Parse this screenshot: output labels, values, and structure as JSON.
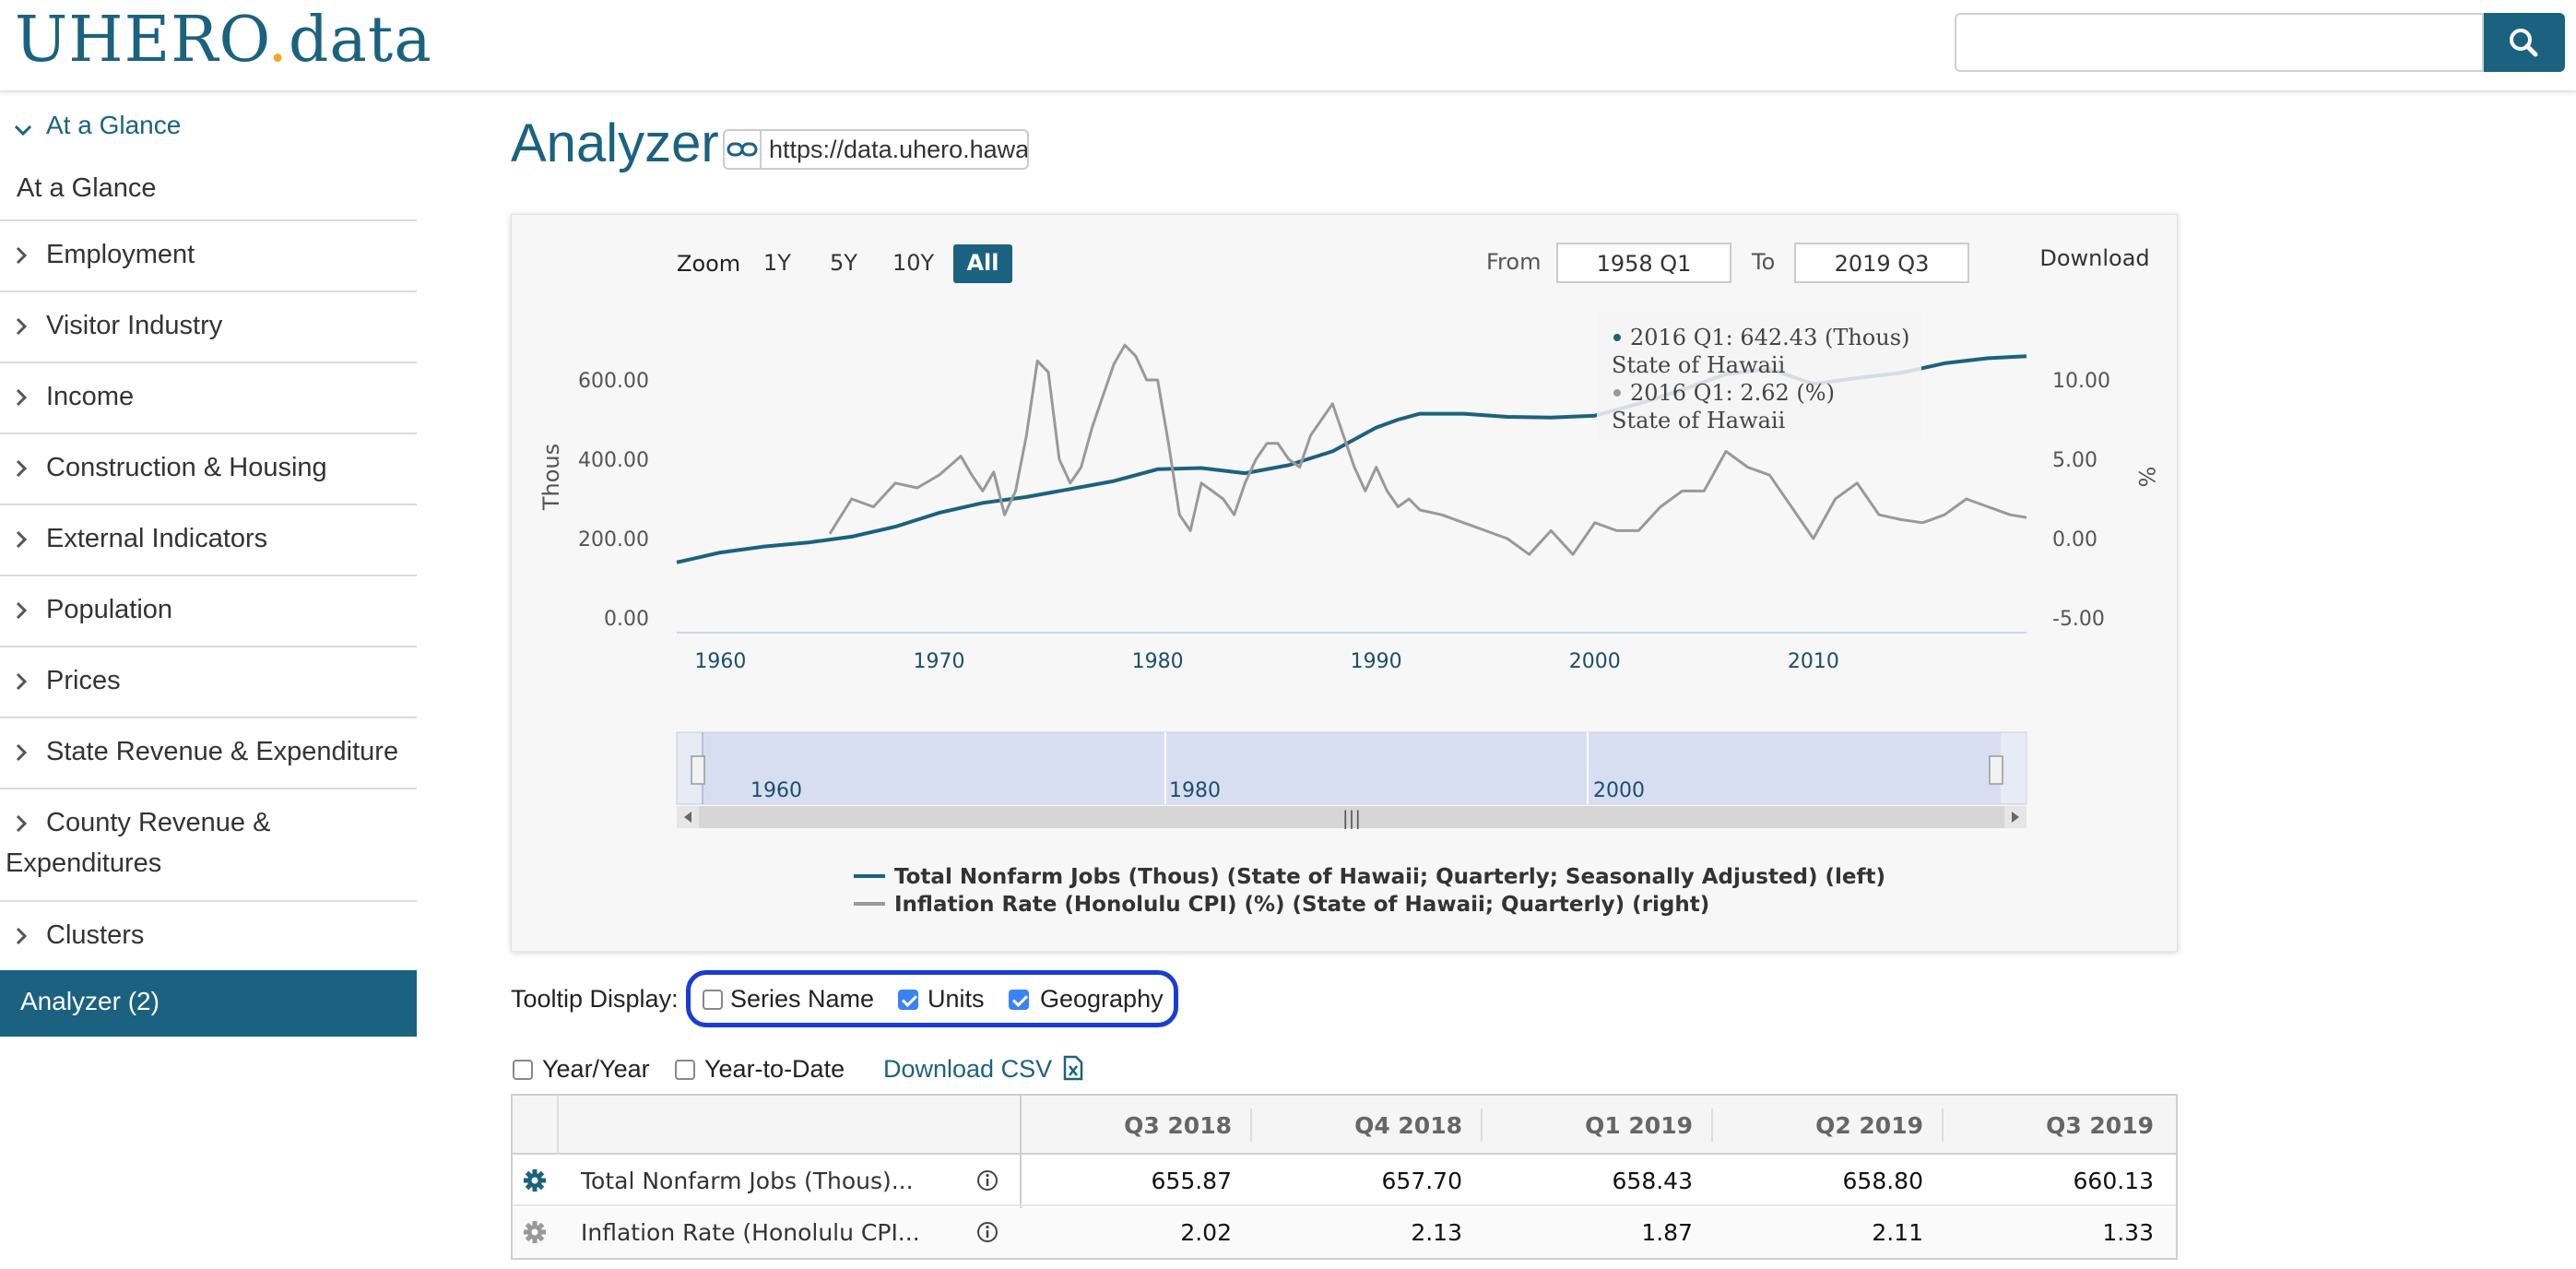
{
  "header": {
    "logo_text_a": "UHERO",
    "logo_text_b": ".",
    "logo_text_c": "data",
    "search_placeholder": ""
  },
  "sidebar": {
    "section_title": "At a Glance",
    "items": [
      {
        "label": "At a Glance",
        "chevron": false
      },
      {
        "label": "Employment",
        "chevron": true
      },
      {
        "label": "Visitor Industry",
        "chevron": true
      },
      {
        "label": "Income",
        "chevron": true
      },
      {
        "label": "Construction & Housing",
        "chevron": true
      },
      {
        "label": "External Indicators",
        "chevron": true
      },
      {
        "label": "Population",
        "chevron": true
      },
      {
        "label": "Prices",
        "chevron": true
      },
      {
        "label": "State Revenue & Expenditure",
        "chevron": true
      },
      {
        "label_line1": "County Revenue &",
        "label_line2": "Expenditures",
        "chevron": true
      },
      {
        "label": "Clusters",
        "chevron": true
      }
    ],
    "active_item": "Analyzer (2)"
  },
  "main": {
    "title": "Analyzer",
    "url_value": "https://data.uhero.hawaii.gov"
  },
  "chart_controls": {
    "zoom_label": "Zoom",
    "zoom_buttons": [
      "1Y",
      "5Y",
      "10Y",
      "All"
    ],
    "zoom_active": "All",
    "from_label": "From",
    "from_value": "1958 Q1",
    "to_label": "To",
    "to_value": "2019 Q3",
    "download_label": "Download"
  },
  "tooltip": {
    "line1": "2016 Q1: 642.43 (Thous)",
    "line2": "State of Hawaii",
    "line3": "2016 Q1: 2.62 (%)",
    "line4": "State of Hawaii"
  },
  "chart_data": {
    "type": "line",
    "x_range": [
      1958,
      2019.75
    ],
    "left_axis": {
      "label": "Thous",
      "ticks": [
        "0.00",
        "200.00",
        "400.00",
        "600.00"
      ],
      "range": [
        0,
        600
      ]
    },
    "right_axis": {
      "label": "%",
      "ticks": [
        "-5.00",
        "0.00",
        "5.00",
        "10.00"
      ],
      "range": [
        -5,
        10
      ]
    },
    "x_ticks": [
      "1960",
      "1970",
      "1980",
      "1990",
      "2000",
      "2010"
    ],
    "navigator_ticks": [
      "1960",
      "1980",
      "2000"
    ],
    "series": [
      {
        "name": "Total Nonfarm Jobs (Thous) (State of Hawaii; Quarterly; Seasonally Adjusted) (left)",
        "color": "#1b6280",
        "axis": "left",
        "x": [
          1958,
          1960,
          1962,
          1964,
          1966,
          1968,
          1970,
          1972,
          1974,
          1976,
          1978,
          1980,
          1982,
          1984,
          1986,
          1988,
          1990,
          1991,
          1992,
          1994,
          1996,
          1998,
          2000,
          2002,
          2004,
          2006,
          2008,
          2010,
          2012,
          2014,
          2016,
          2018,
          2019.75
        ],
        "y": [
          140,
          165,
          180,
          190,
          205,
          230,
          265,
          290,
          305,
          325,
          345,
          375,
          378,
          365,
          385,
          420,
          480,
          500,
          515,
          515,
          507,
          505,
          510,
          540,
          575,
          615,
          628,
          590,
          605,
          618,
          642,
          655,
          660
        ]
      },
      {
        "name": "Inflation Rate (Honolulu CPI) (%) (State of Hawaii; Quarterly) (right)",
        "color": "#999999",
        "axis": "right",
        "x": [
          1965,
          1966,
          1967,
          1968,
          1969,
          1970,
          1971,
          1971.5,
          1972,
          1972.5,
          1973,
          1973.5,
          1974,
          1974.5,
          1975,
          1975.5,
          1976,
          1976.5,
          1977,
          1977.5,
          1978,
          1978.5,
          1979,
          1979.5,
          1980,
          1980.5,
          1981,
          1981.5,
          1982,
          1982.5,
          1983,
          1983.5,
          1984,
          1984.5,
          1985,
          1985.5,
          1986,
          1986.5,
          1987,
          1987.5,
          1988,
          1988.5,
          1989,
          1989.5,
          1990,
          1990.5,
          1991,
          1991.5,
          1992,
          1993,
          1994,
          1995,
          1996,
          1997,
          1998,
          1999,
          2000,
          2001,
          2002,
          2003,
          2004,
          2005,
          2006,
          2007,
          2008,
          2009,
          2010,
          2011,
          2012,
          2013,
          2014,
          2015,
          2016,
          2017,
          2018,
          2019,
          2019.75
        ],
        "y": [
          0.3,
          2.5,
          2.0,
          3.5,
          3.2,
          4.0,
          5.2,
          4.0,
          3.0,
          4.2,
          1.5,
          3.0,
          6.5,
          11.2,
          10.5,
          5.0,
          3.5,
          4.5,
          7.0,
          9.0,
          11.0,
          12.2,
          11.5,
          10.0,
          10.0,
          6.0,
          1.5,
          0.5,
          3.5,
          3.0,
          2.5,
          1.5,
          3.5,
          5.0,
          6.0,
          6.0,
          5.0,
          4.5,
          6.5,
          7.5,
          8.5,
          6.5,
          4.5,
          3.0,
          4.5,
          3.0,
          2.0,
          2.5,
          1.8,
          1.5,
          1.0,
          0.5,
          0.0,
          -1.0,
          0.5,
          -1.0,
          1.0,
          0.5,
          0.5,
          2.0,
          3.0,
          3.0,
          5.5,
          4.5,
          4.0,
          2.0,
          0.0,
          2.5,
          3.5,
          1.5,
          1.2,
          1.0,
          1.5,
          2.5,
          2.0,
          1.5,
          1.33
        ]
      }
    ]
  },
  "legend": {
    "series_1": "Total Nonfarm Jobs (Thous) (State of Hawaii; Quarterly; Seasonally Adjusted) (left)",
    "series_2": "Inflation Rate (Honolulu CPI) (%) (State of Hawaii; Quarterly) (right)"
  },
  "tooltip_display": {
    "label": "Tooltip Display:",
    "options": [
      {
        "label": "Series Name",
        "checked": false
      },
      {
        "label": "Units",
        "checked": true
      },
      {
        "label": "Geography",
        "checked": true
      }
    ]
  },
  "table_options": {
    "year_year": "Year/Year",
    "year_to_date": "Year-to-Date",
    "download_csv": "Download CSV"
  },
  "table": {
    "columns": [
      "Q3 2018",
      "Q4 2018",
      "Q1 2019",
      "Q2 2019",
      "Q3 2019"
    ],
    "rows": [
      {
        "name": "Total Nonfarm Jobs (Thous)...",
        "values": [
          "655.87",
          "657.70",
          "658.43",
          "658.80",
          "660.13"
        ]
      },
      {
        "name": "Inflation Rate (Honolulu CPI...",
        "values": [
          "2.02",
          "2.13",
          "1.87",
          "2.11",
          "1.33"
        ]
      }
    ]
  },
  "colors": {
    "brand": "#1b6280",
    "accent": "#f5a623",
    "highlight": "#1a3cd6",
    "series2": "#999999"
  }
}
